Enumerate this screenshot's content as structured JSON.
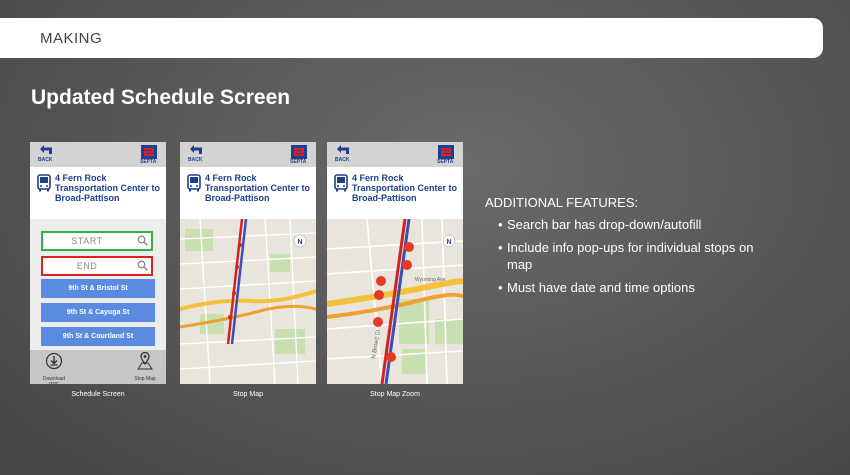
{
  "header": {
    "label": "MAKING"
  },
  "page_title": "Updated Schedule Screen",
  "phone": {
    "back_label": "BACK",
    "brand_label": "SEPTA",
    "route_text": "4 Fern Rock Transportation Center to Broad-Pattison"
  },
  "schedule": {
    "start_placeholder": "START",
    "end_placeholder": "END",
    "stops": [
      "9th St & Bristol St",
      "9th St & Cayuga St",
      "9th St & Courtland St"
    ],
    "download_label": "Download PDF",
    "stop_map_label": "Stop Map"
  },
  "captions": [
    "Schedule Screen",
    "Stop Map",
    "Stop Map Zoom"
  ],
  "features": {
    "title": "ADDITIONAL FEATURES:",
    "items": [
      "Search bar has drop-down/autofill",
      "Include info pop-ups for individual stops on map",
      "Must have date and time options"
    ]
  },
  "map_labels": {
    "street": "N Broad St",
    "area": "Wyoming Ave"
  },
  "colors": {
    "brand_blue": "#1d3f8f",
    "start_border": "#2db34a",
    "end_border": "#e02020",
    "stop_button": "#5b8be0",
    "route_line_red": "#d32222",
    "route_line_blue": "#3b4fb8"
  }
}
